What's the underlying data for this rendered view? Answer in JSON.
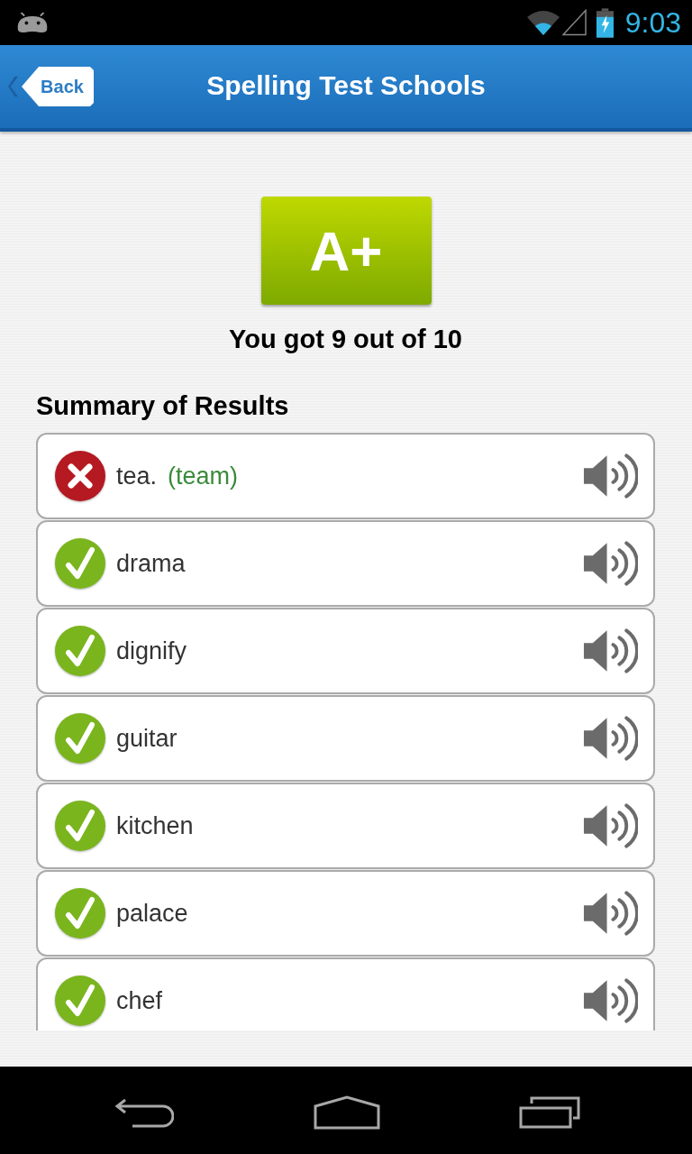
{
  "status_bar": {
    "time": "9:03"
  },
  "header": {
    "back_label": "Back",
    "title": "Spelling Test Schools"
  },
  "grade": {
    "label": "A+",
    "score_text": "You got 9 out of 10"
  },
  "summary": {
    "heading": "Summary of Results",
    "items": [
      {
        "word": "tea.",
        "correct": false,
        "correction": "(team)"
      },
      {
        "word": "drama",
        "correct": true
      },
      {
        "word": "dignify",
        "correct": true
      },
      {
        "word": "guitar",
        "correct": true
      },
      {
        "word": "kitchen",
        "correct": true
      },
      {
        "word": "palace",
        "correct": true
      },
      {
        "word": "chef",
        "correct": true
      }
    ]
  }
}
